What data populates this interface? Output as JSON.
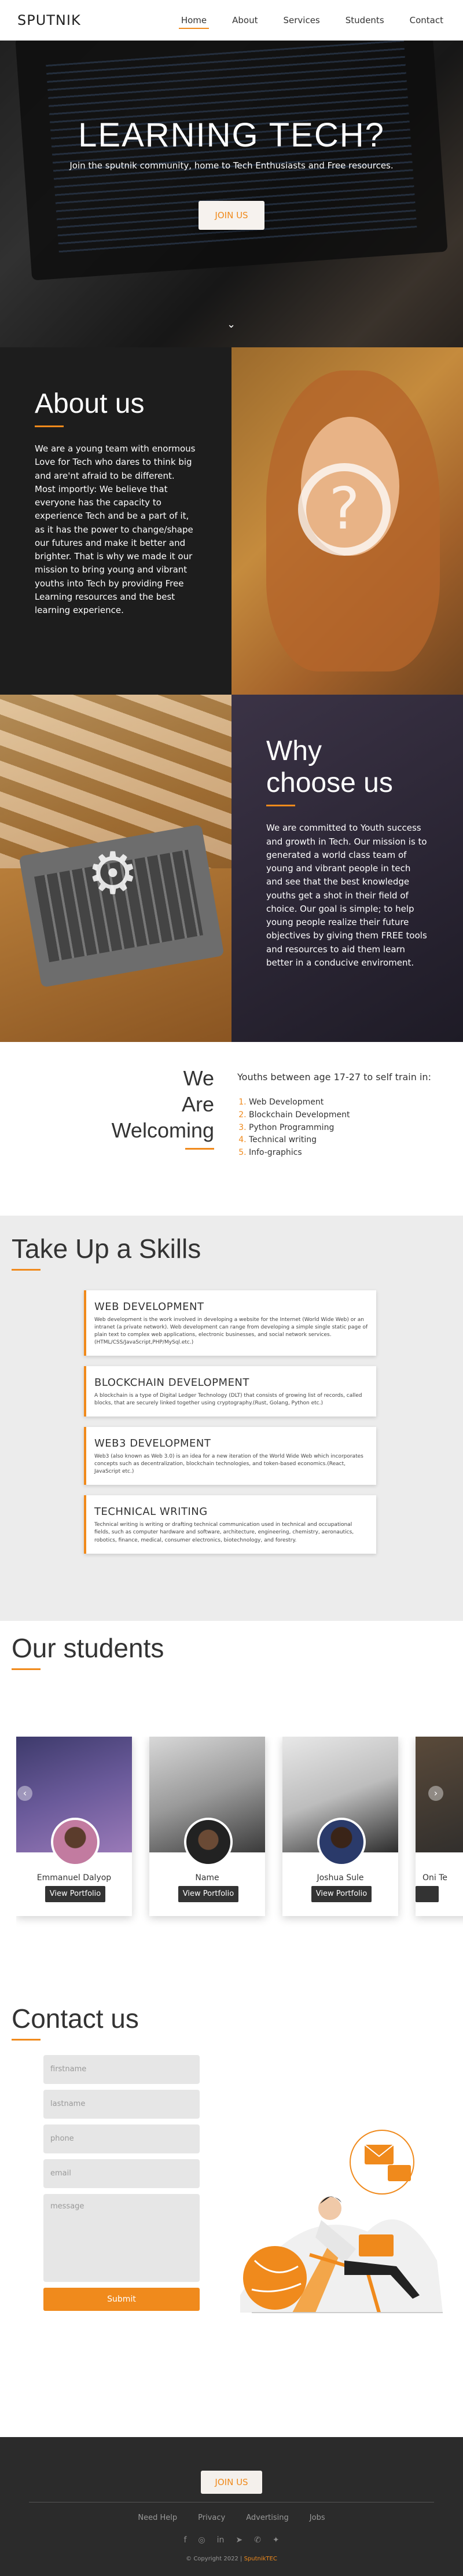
{
  "nav": {
    "logo": "SPUTNIK",
    "items": [
      "Home",
      "About",
      "Services",
      "Students",
      "Contact"
    ]
  },
  "hero": {
    "title": "LEARNING TECH?",
    "subtitle": "Join the sputnik community, home to Tech Enthusiasts and Free resources.",
    "button": "JOIN US",
    "arrow": "⌄"
  },
  "about": {
    "title": "About us",
    "text": "We are a young team with enormous Love for Tech who dares to think big and are'nt afraid to be different. Most importly: We believe that everyone has the capacity to experience Tech and be a part of it, as it has the power to change/shape our futures and make it better and brighter. That is why we made it our mission to bring young and vibrant youths into Tech by providing Free Learning resources and the best learning experience."
  },
  "why": {
    "title_1": "Why",
    "title_2": "choose us",
    "text": "We are committed to Youth success and growth in Tech. Our mission is to generated a world class team of young and vibrant people in tech and see that the best knowledge youths get a shot in their field of choice. Our goal is simple; to help young people realize their future objectives by giving them FREE tools and resources to aid them learn better in a conducive enviroment."
  },
  "welcome": {
    "w1": "We",
    "w2": "Are",
    "w3": "Welcoming",
    "heading": "Youths between age 17-27 to self train in:",
    "items": [
      "Web Development",
      "Blockchain Development",
      "Python Programming",
      "Technical writing",
      "Info-graphics"
    ]
  },
  "skills": {
    "title": "Take Up a Skills",
    "cards": [
      {
        "title": "WEB DEVELOPMENT",
        "text": "Web development is the work involved in developing a website for the Internet (World Wide Web) or an intranet (a private network). Web development can range from developing a simple single static page of plain text to complex web applications, electronic businesses, and social network services.(HTML/CSS/JavaScript,PHP/MySql.etc.)"
      },
      {
        "title": "BLOCKCHAIN DEVELOPMENT",
        "text": "A blockchain is a type of Digital Ledger Technology (DLT) that consists of growing list of records, called blocks, that are securely linked together using cryptography.(Rust, Golang, Python etc.)"
      },
      {
        "title": "WEB3 DEVELOPMENT",
        "text": "Web3 (also known as Web 3.0) is an idea for a new iteration of the World Wide Web which incorporates concepts such as decentralization, blockchain technologies, and token-based economics.(React, JavaScript etc.)"
      },
      {
        "title": "TECHNICAL WRITING",
        "text": "Technical writing is writing or drafting technical communication used in technical and occupational fields, such as computer hardware and software, architecture, engineering, chemistry, aeronautics, robotics, finance, medical, consumer electronics, biotechnology, and forestry."
      }
    ]
  },
  "students": {
    "title": "Our students",
    "cards": [
      {
        "name": "Emmanuel Dalyop",
        "button": "View Portfolio"
      },
      {
        "name": "Name",
        "button": "View Portfolio"
      },
      {
        "name": "Joshua Sule",
        "button": "View Portfolio"
      },
      {
        "name": "Oni Te",
        "button": "View Portfolio"
      }
    ],
    "prev": "‹",
    "next": "›"
  },
  "contact": {
    "title": "Contact us",
    "firstname": "firstname",
    "lastname": "lastname",
    "phone": "phone",
    "email": "email",
    "message": "message",
    "submit": "Submit"
  },
  "footer": {
    "button": "JOIN US",
    "links": [
      "Need Help",
      "Privacy",
      "Advertising",
      "Jobs"
    ],
    "icons": [
      "facebook-icon",
      "instagram-icon",
      "linkedin-icon",
      "telegram-icon",
      "whatsapp-icon",
      "twitter-icon"
    ],
    "copyright": "Copyright 2022",
    "brand": "SputnikTEC"
  },
  "colors": {
    "accent": "#f08a1c",
    "dark": "#1d1d1d",
    "footer": "#2b2b2b"
  }
}
